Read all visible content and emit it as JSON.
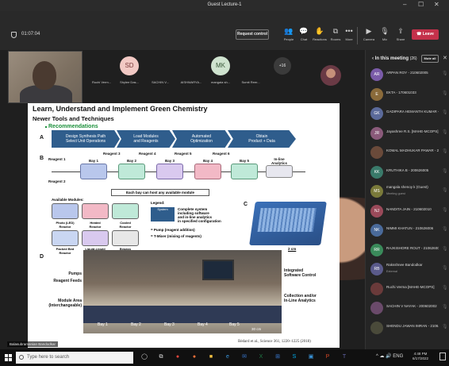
{
  "window": {
    "title": "Guest Lecture-1",
    "controls": [
      "–",
      "☐",
      "✕"
    ]
  },
  "meeting": {
    "timer": "01:07:04",
    "request_control": "Request control",
    "toolbar": [
      {
        "icon": "people-icon",
        "glyph": "👥",
        "label": "People"
      },
      {
        "icon": "chat-icon",
        "glyph": "💬",
        "label": "Chat"
      },
      {
        "icon": "reactions-icon",
        "glyph": "✋",
        "label": "Reactions"
      },
      {
        "icon": "rooms-icon",
        "glyph": "⧉",
        "label": "Rooms"
      },
      {
        "icon": "more-icon",
        "glyph": "•••",
        "label": "More"
      },
      {
        "icon": "camera-icon",
        "glyph": "▶",
        "label": "Camera"
      },
      {
        "icon": "mic-icon",
        "glyph": "🎙",
        "label": "Mic"
      },
      {
        "icon": "share-icon",
        "glyph": "⇪",
        "label": "Share"
      }
    ],
    "leave": "Leave"
  },
  "strip": {
    "participants": [
      {
        "initials": "",
        "name": "Ruchi Verm...",
        "bg": "#6b4a3a"
      },
      {
        "initials": "SD",
        "name": "Shylee Das...",
        "bg": "#f2c9c4"
      },
      {
        "initials": "",
        "name": "SACHIN V...",
        "bg": "#7a4c6a"
      },
      {
        "initials": "",
        "name": "AISHWARYA...",
        "bg": "#5b3a2c"
      },
      {
        "initials": "MK",
        "name": "mangala sh...",
        "bg": "#cfe3cf"
      },
      {
        "initials": "",
        "name": "Sumit Reer...",
        "bg": "#6a5a3a"
      }
    ],
    "more": "+16"
  },
  "slide": {
    "title": "Learn, Understand and Implement Green Chemistry",
    "subtitle": "Newer Tools and Techniques",
    "recommendations": "Recommendations",
    "sec_a": "A",
    "sec_b": "B",
    "sec_c": "C",
    "sec_d": "D",
    "steps": [
      "Design Synthesis Path\nSelect Unit Operations",
      "Load Modules\nand Reagents",
      "Automated\nOptimization",
      "Obtain\nProduct + Data"
    ],
    "reagents": [
      "Reagent 1",
      "Reagent 2",
      "Reagent 3",
      "Reagent 4",
      "Reagent 5",
      "Reagent 6"
    ],
    "bays": [
      "Bay 1",
      "Bay 2",
      "Bay 3",
      "Bay 4",
      "Bay 5",
      "In-line\nAnalytics"
    ],
    "host_note": "Each bay can host any available module",
    "available_modules": "Available Modules:",
    "modules": [
      {
        "name": "Photo (LED)\nReactor",
        "color": "#b9c7ec"
      },
      {
        "name": "Heated\nReactor",
        "color": "#f2b9c6"
      },
      {
        "name": "Cooled\nReactor",
        "color": "#bfe9d8"
      },
      {
        "name": "Packed Bed\nReactor",
        "color": "#c9d6f2"
      },
      {
        "name": "Liquid-Liquid\nSeparator",
        "color": "#d9c9ef"
      },
      {
        "name": "Bypass",
        "color": "#e7e7e7"
      }
    ],
    "legend_title": "Legend:",
    "legend_system": "System",
    "legend_system_desc": "Complete system\nincluding software\nand in-line analytics\nin specified configuration",
    "legend_pump": "= Pump (reagent addition)",
    "legend_tmixer": "= T-Mixer (mixing of reagents)",
    "scale_c": "2 cm",
    "photo_labels": {
      "pumps": "Pumps",
      "reagent_feeds": "Reagent Feeds",
      "module_area": "Module Area\n(Interchangeable)",
      "software": "Integrated\nSoftware Control",
      "collection": "Collection and/or\nIn-Line Analytics"
    },
    "photo_bays": [
      "Bay 1",
      "Bay 2",
      "Bay 3",
      "Bay 4",
      "Bay 5"
    ],
    "scale_d": "30 cm",
    "citation": "Bédard et al., Science 361, 1220–1225 (2018)"
  },
  "presenter_label": "Balasubramanian Bandodkar",
  "panel": {
    "title": "In this meeting",
    "count": "(26)",
    "mute_all": "Mute all",
    "people": [
      {
        "initials": "",
        "name": "",
        "sub": "",
        "bg": "#4a4a4a"
      },
      {
        "initials": "AR",
        "name": "ARPAN ROY - 210602005",
        "sub": "",
        "bg": "#7a5ba8"
      },
      {
        "initials": "E",
        "name": "EKTA - 170601033",
        "sub": "",
        "bg": "#8a6a3a"
      },
      {
        "initials": "GK",
        "name": "GADIPARA HEMANTH KUMAR - ...",
        "sub": "",
        "bg": "#5b6a9a"
      },
      {
        "initials": "JR",
        "name": "Jayashree R.S. [MAHE-MCOPS]",
        "sub": "",
        "bg": "#8a5a7a"
      },
      {
        "initials": "",
        "name": "KOMAL MADHUKAR PAWAR - 2...",
        "sub": "",
        "bg": "#6a4a3a"
      },
      {
        "initials": "KK",
        "name": "KRUTHIKA B - 200626005",
        "sub": "",
        "bg": "#3a7a6a"
      },
      {
        "initials": "MS",
        "name": "mangala shenoy k (Guest)",
        "sub": "Meeting guest",
        "bg": "#7a7a3a"
      },
      {
        "initials": "NJ",
        "name": "NANDITA JAIN - 210602010",
        "sub": "",
        "bg": "#9a4a5a"
      },
      {
        "initials": "NK",
        "name": "NIMMI KHATUN - 210626006",
        "sub": "",
        "bg": "#4a6a9a"
      },
      {
        "initials": "RR",
        "name": "RAJKISHORE ROUT - 210626007",
        "sub": "",
        "bg": "#3a8a5a"
      },
      {
        "initials": "RB",
        "name": "Raksshnee Bandodkar",
        "sub": "External",
        "bg": "#5a5a8a"
      },
      {
        "initials": "",
        "name": "Ruchi Verma [MAHE-MCOPS]",
        "sub": "",
        "bg": "#6a3a3a"
      },
      {
        "initials": "",
        "name": "SACHIN V NAYAK - 200602002",
        "sub": "",
        "bg": "#6a4a6a"
      },
      {
        "initials": "",
        "name": "SHENDU JAWAN IMRAN - 2106...",
        "sub": "",
        "bg": "#4a4a3a"
      }
    ]
  },
  "taskbar": {
    "search_placeholder": "Type here to search",
    "apps": [
      {
        "icon": "cortana-icon",
        "glyph": "◯",
        "color": "#dddddd"
      },
      {
        "icon": "task-view-icon",
        "glyph": "⧉",
        "color": "#dddddd"
      },
      {
        "icon": "chrome-icon",
        "glyph": "●",
        "color": "#e8453c"
      },
      {
        "icon": "firefox-icon",
        "glyph": "●",
        "color": "#ff7139"
      },
      {
        "icon": "file-explorer-icon",
        "glyph": "■",
        "color": "#f5c242"
      },
      {
        "icon": "edge-icon",
        "glyph": "e",
        "color": "#3a96dd"
      },
      {
        "icon": "mail-icon",
        "glyph": "✉",
        "color": "#3a7bd5"
      },
      {
        "icon": "excel-icon",
        "glyph": "X",
        "color": "#1f7a44"
      },
      {
        "icon": "store-icon",
        "glyph": "⊞",
        "color": "#3a7bd5"
      },
      {
        "icon": "skype-icon",
        "glyph": "S",
        "color": "#00aff0"
      },
      {
        "icon": "photos-icon",
        "glyph": "▣",
        "color": "#3a96dd"
      },
      {
        "icon": "powerpoint-icon",
        "glyph": "P",
        "color": "#d24726"
      },
      {
        "icon": "teams-icon",
        "glyph": "T",
        "color": "#6264a7"
      }
    ],
    "time": "4:48 PM",
    "date": "6/17/2022"
  }
}
